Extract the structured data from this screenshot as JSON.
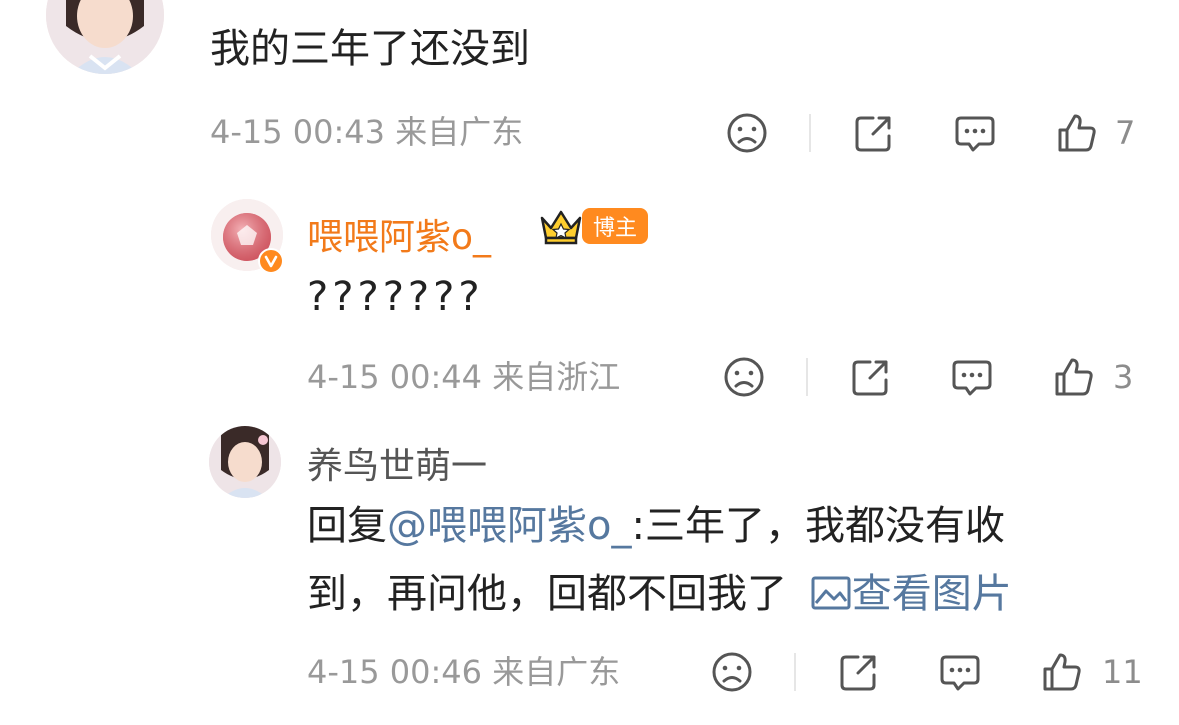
{
  "comment1": {
    "text": "我的三年了还没到",
    "meta": "4-15 00:43 来自广东",
    "like_count": "7"
  },
  "reply1": {
    "username": "喂喂阿紫o_",
    "host_badge": "博主",
    "text": "???????",
    "meta": "4-15 00:44 来自浙江",
    "like_count": "3"
  },
  "reply2": {
    "username": "养鸟世萌一",
    "reply_prefix": "回复",
    "mention": "@喂喂阿紫o_",
    "text_after_mention": ":三年了，我都没有收",
    "text_line2": "到，再问他，回都不回我了",
    "view_image_label": "查看图片",
    "meta": "4-15 00:46 来自广东",
    "like_count": "11"
  },
  "icons": {
    "sad_face": "sad-face-icon",
    "share": "share-icon",
    "comment": "comment-icon",
    "like": "thumbs-up-icon",
    "crown": "crown-icon",
    "verified": "verified-v-icon",
    "image": "image-icon"
  },
  "colors": {
    "orange_name": "#f27a1a",
    "link_blue": "#56789f",
    "meta_gray": "#999999"
  }
}
